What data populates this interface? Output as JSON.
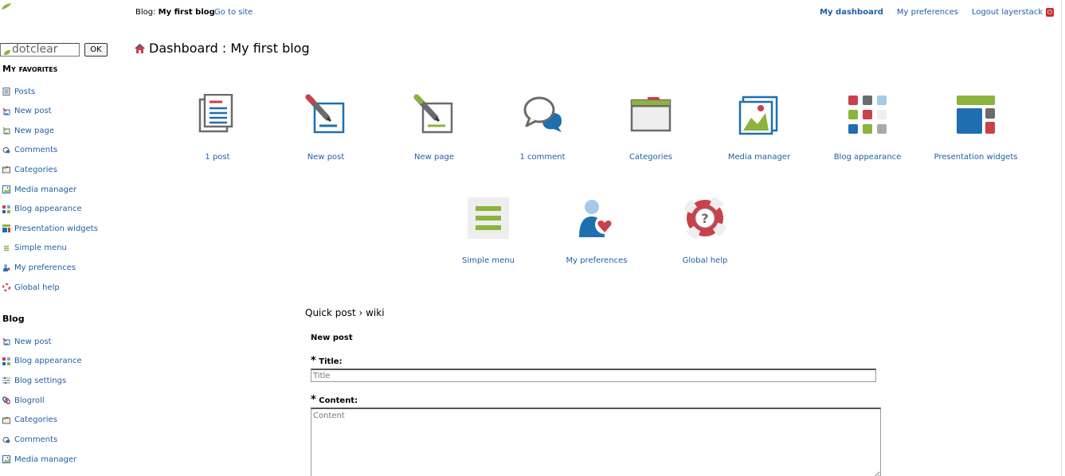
{
  "topbar": {
    "blog_prefix": "Blog:",
    "blog_name": "My first blog",
    "go_to_site": "Go to site",
    "my_dashboard": "My dashboard",
    "my_preferences": "My preferences",
    "logout": "Logout layerstack"
  },
  "sidebar": {
    "search_value": "dotclear",
    "ok_label": "OK",
    "favorites_title": "My favorites",
    "favorites": [
      {
        "label": "Posts",
        "icon": "posts-icon"
      },
      {
        "label": "New post",
        "icon": "new-post-icon"
      },
      {
        "label": "New page",
        "icon": "new-page-icon"
      },
      {
        "label": "Comments",
        "icon": "comments-icon"
      },
      {
        "label": "Categories",
        "icon": "categories-icon"
      },
      {
        "label": "Media manager",
        "icon": "media-icon"
      },
      {
        "label": "Blog appearance",
        "icon": "appearance-icon"
      },
      {
        "label": "Presentation widgets",
        "icon": "widgets-icon"
      },
      {
        "label": "Simple menu",
        "icon": "menu-icon"
      },
      {
        "label": "My preferences",
        "icon": "preferences-icon"
      },
      {
        "label": "Global help",
        "icon": "help-icon"
      }
    ],
    "blog_title": "Blog",
    "blog_items": [
      {
        "label": "New post",
        "icon": "new-post-icon"
      },
      {
        "label": "Blog appearance",
        "icon": "appearance-icon"
      },
      {
        "label": "Blog settings",
        "icon": "settings-icon"
      },
      {
        "label": "Blogroll",
        "icon": "blogroll-icon"
      },
      {
        "label": "Categories",
        "icon": "categories-icon"
      },
      {
        "label": "Comments",
        "icon": "comments-icon"
      },
      {
        "label": "Media manager",
        "icon": "media-icon"
      }
    ]
  },
  "main": {
    "title": "Dashboard : My first blog",
    "tiles_row1": [
      {
        "label": "1 post",
        "icon": "posts-icon"
      },
      {
        "label": "New post",
        "icon": "new-post-icon"
      },
      {
        "label": "New page",
        "icon": "new-page-icon"
      },
      {
        "label": "1 comment",
        "icon": "comments-icon"
      },
      {
        "label": "Categories",
        "icon": "categories-icon"
      },
      {
        "label": "Media manager",
        "icon": "media-icon"
      },
      {
        "label": "Blog appearance",
        "icon": "appearance-icon"
      },
      {
        "label": "Presentation widgets",
        "icon": "widgets-icon"
      }
    ],
    "tiles_row2": [
      {
        "label": "Simple menu",
        "icon": "menu-icon"
      },
      {
        "label": "My preferences",
        "icon": "preferences-icon"
      },
      {
        "label": "Global help",
        "icon": "help-icon"
      }
    ]
  },
  "quickpost": {
    "title": "Quick post › wiki",
    "new_post": "New post",
    "title_label": "Title:",
    "title_placeholder": "Title",
    "content_label": "Content:",
    "content_placeholder": "Content"
  },
  "colors": {
    "link": "#1f5fa6",
    "accent_green": "#8cb33c",
    "accent_red": "#c8414b",
    "icon_gray": "#6b6b6b"
  }
}
